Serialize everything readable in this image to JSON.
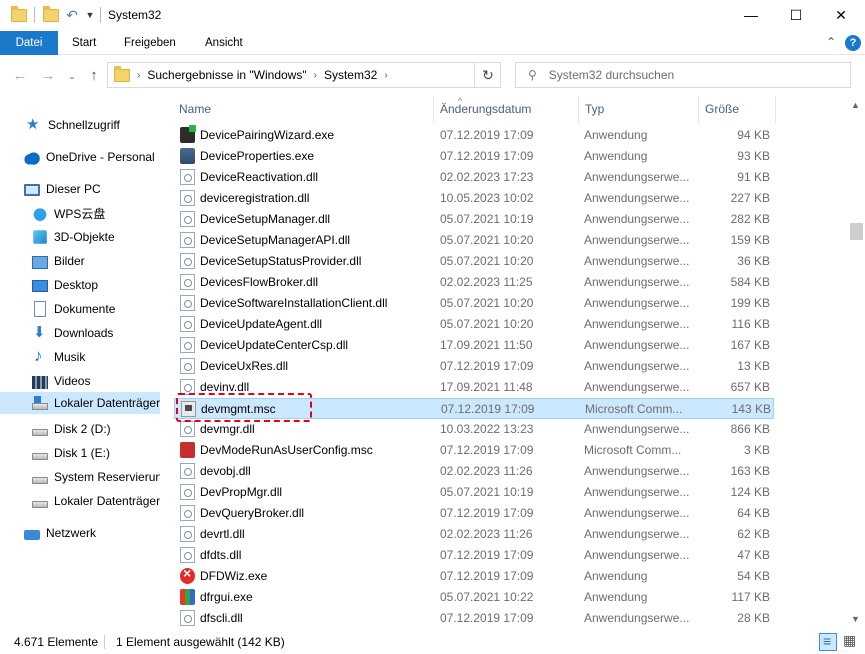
{
  "window": {
    "title": "System32",
    "minimize": "—",
    "maximize": "☐",
    "close": "✕"
  },
  "ribbon": {
    "tabs": [
      "Datei",
      "Start",
      "Freigeben",
      "Ansicht"
    ],
    "collapse": "⌃",
    "help": "?"
  },
  "address": {
    "segments": [
      "Suchergebnisse in \"Windows\"",
      "System32"
    ],
    "search_placeholder": "System32 durchsuchen"
  },
  "navigation": [
    {
      "label": "Schnellzugriff",
      "icon": "star-icon"
    },
    {
      "label": "OneDrive - Personal",
      "icon": "cloud-icon"
    },
    {
      "label": "Dieser PC",
      "icon": "pc-icon"
    },
    {
      "label": "WPS云盘",
      "icon": "wps-cloud-icon"
    },
    {
      "label": "3D-Objekte",
      "icon": "3d-objects-icon"
    },
    {
      "label": "Bilder",
      "icon": "pictures-icon"
    },
    {
      "label": "Desktop",
      "icon": "desktop-icon"
    },
    {
      "label": "Dokumente",
      "icon": "documents-icon"
    },
    {
      "label": "Downloads",
      "icon": "download-icon"
    },
    {
      "label": "Musik",
      "icon": "music-icon"
    },
    {
      "label": "Videos",
      "icon": "videos-icon"
    },
    {
      "label": "Lokaler Datenträger",
      "icon": "windows-drive-icon",
      "selected": true
    },
    {
      "label": "Disk 2 (D:)",
      "icon": "drive-icon"
    },
    {
      "label": "Disk 1 (E:)",
      "icon": "drive-icon"
    },
    {
      "label": "System Reservierung",
      "icon": "drive-icon"
    },
    {
      "label": "Lokaler Datenträger",
      "icon": "drive-icon"
    },
    {
      "label": "Netzwerk",
      "icon": "network-icon"
    }
  ],
  "columns": [
    "Name",
    "Änderungsdatum",
    "Typ",
    "Größe"
  ],
  "files": [
    {
      "name": "DevicePairingWizard.exe",
      "date": "07.12.2019 17:09",
      "type": "Anwendung",
      "size": "94 KB",
      "icon": "wiz"
    },
    {
      "name": "DeviceProperties.exe",
      "date": "07.12.2019 17:09",
      "type": "Anwendung",
      "size": "93 KB",
      "icon": "exe"
    },
    {
      "name": "DeviceReactivation.dll",
      "date": "02.02.2023 17:23",
      "type": "Anwendungserwe...",
      "size": "91 KB",
      "icon": "dll"
    },
    {
      "name": "deviceregistration.dll",
      "date": "10.05.2023 10:02",
      "type": "Anwendungserwe...",
      "size": "227 KB",
      "icon": "dll"
    },
    {
      "name": "DeviceSetupManager.dll",
      "date": "05.07.2021 10:19",
      "type": "Anwendungserwe...",
      "size": "282 KB",
      "icon": "dll"
    },
    {
      "name": "DeviceSetupManagerAPI.dll",
      "date": "05.07.2021 10:20",
      "type": "Anwendungserwe...",
      "size": "159 KB",
      "icon": "dll"
    },
    {
      "name": "DeviceSetupStatusProvider.dll",
      "date": "05.07.2021 10:20",
      "type": "Anwendungserwe...",
      "size": "36 KB",
      "icon": "dll"
    },
    {
      "name": "DevicesFlowBroker.dll",
      "date": "02.02.2023 11:25",
      "type": "Anwendungserwe...",
      "size": "584 KB",
      "icon": "dll"
    },
    {
      "name": "DeviceSoftwareInstallationClient.dll",
      "date": "05.07.2021 10:20",
      "type": "Anwendungserwe...",
      "size": "199 KB",
      "icon": "dll"
    },
    {
      "name": "DeviceUpdateAgent.dll",
      "date": "05.07.2021 10:20",
      "type": "Anwendungserwe...",
      "size": "116 KB",
      "icon": "dll"
    },
    {
      "name": "DeviceUpdateCenterCsp.dll",
      "date": "17.09.2021 11:50",
      "type": "Anwendungserwe...",
      "size": "167 KB",
      "icon": "dll"
    },
    {
      "name": "DeviceUxRes.dll",
      "date": "07.12.2019 17:09",
      "type": "Anwendungserwe...",
      "size": "13 KB",
      "icon": "dll"
    },
    {
      "name": "devinv.dll",
      "date": "17.09.2021 11:48",
      "type": "Anwendungserwe...",
      "size": "657 KB",
      "icon": "dll"
    },
    {
      "name": "devmgmt.msc",
      "date": "07.12.2019 17:09",
      "type": "Microsoft Comm...",
      "size": "143 KB",
      "icon": "msc",
      "selected": true
    },
    {
      "name": "devmgr.dll",
      "date": "10.03.2022 13:23",
      "type": "Anwendungserwe...",
      "size": "866 KB",
      "icon": "dll"
    },
    {
      "name": "DevModeRunAsUserConfig.msc",
      "date": "07.12.2019 17:09",
      "type": "Microsoft Comm...",
      "size": "3 KB",
      "icon": "run"
    },
    {
      "name": "devobj.dll",
      "date": "02.02.2023 11:26",
      "type": "Anwendungserwe...",
      "size": "163 KB",
      "icon": "dll"
    },
    {
      "name": "DevPropMgr.dll",
      "date": "05.07.2021 10:19",
      "type": "Anwendungserwe...",
      "size": "124 KB",
      "icon": "dll"
    },
    {
      "name": "DevQueryBroker.dll",
      "date": "07.12.2019 17:09",
      "type": "Anwendungserwe...",
      "size": "64 KB",
      "icon": "dll"
    },
    {
      "name": "devrtl.dll",
      "date": "02.02.2023 11:26",
      "type": "Anwendungserwe...",
      "size": "62 KB",
      "icon": "dll"
    },
    {
      "name": "dfdts.dll",
      "date": "07.12.2019 17:09",
      "type": "Anwendungserwe...",
      "size": "47 KB",
      "icon": "dll"
    },
    {
      "name": "DFDWiz.exe",
      "date": "07.12.2019 17:09",
      "type": "Anwendung",
      "size": "54 KB",
      "icon": "err"
    },
    {
      "name": "dfrgui.exe",
      "date": "05.07.2021 10:22",
      "type": "Anwendung",
      "size": "117 KB",
      "icon": "gui"
    },
    {
      "name": "dfscli.dll",
      "date": "07.12.2019 17:09",
      "type": "Anwendungserwe...",
      "size": "28 KB",
      "icon": "dll"
    }
  ],
  "status": {
    "count": "4.671 Elemente",
    "selection": "1 Element ausgewählt (142 KB)"
  },
  "colors": {
    "accent": "#1979ca",
    "selection": "#cce8ff",
    "highlight": "#e3001b"
  }
}
